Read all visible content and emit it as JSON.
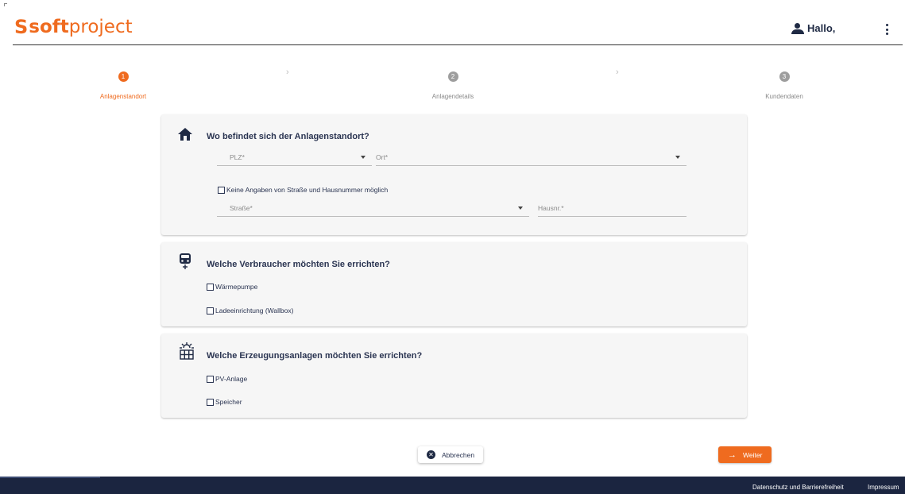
{
  "header": {
    "logo_s": "S",
    "logo_soft": "soft",
    "logo_project": "project",
    "greeting": "Hallo,"
  },
  "stepper": {
    "steps": [
      {
        "number": "1",
        "label": "Anlagenstandort",
        "active": true
      },
      {
        "number": "2",
        "label": "Anlagendetails",
        "active": false
      },
      {
        "number": "3",
        "label": "Kundendaten",
        "active": false
      }
    ],
    "separator": "›"
  },
  "location": {
    "title": "Wo befindet sich der Anlagenstandort?",
    "plz_placeholder": "PLZ*",
    "ort_placeholder": "Ort*",
    "no_street_label": "Keine Angaben von Straße und Hausnummer möglich",
    "street_placeholder": "Straße*",
    "house_placeholder": "Hausnr.*"
  },
  "consumers": {
    "title": "Welche Verbraucher möchten Sie errichten?",
    "options": [
      "Wärmepumpe",
      "Ladeeinrichtung (Wallbox)"
    ]
  },
  "generation": {
    "title": "Welche Erzeugungsanlagen möchten Sie errichten?",
    "options": [
      "PV-Anlage",
      "Speicher"
    ]
  },
  "actions": {
    "cancel_label": "Abbrechen",
    "next_label": "Weiter",
    "next_arrow": "→",
    "cancel_icon": "✕"
  },
  "footer": {
    "privacy_label": "Datenschutz und Barrierefreiheit",
    "imprint_label": "Impressum"
  },
  "icons": {
    "home": "home-icon",
    "car": "car-icon",
    "solar": "solar-panel-icon"
  },
  "colors": {
    "accent": "#ef6b1f",
    "navy": "#1b2540",
    "card_bg": "#f6f6f6"
  }
}
